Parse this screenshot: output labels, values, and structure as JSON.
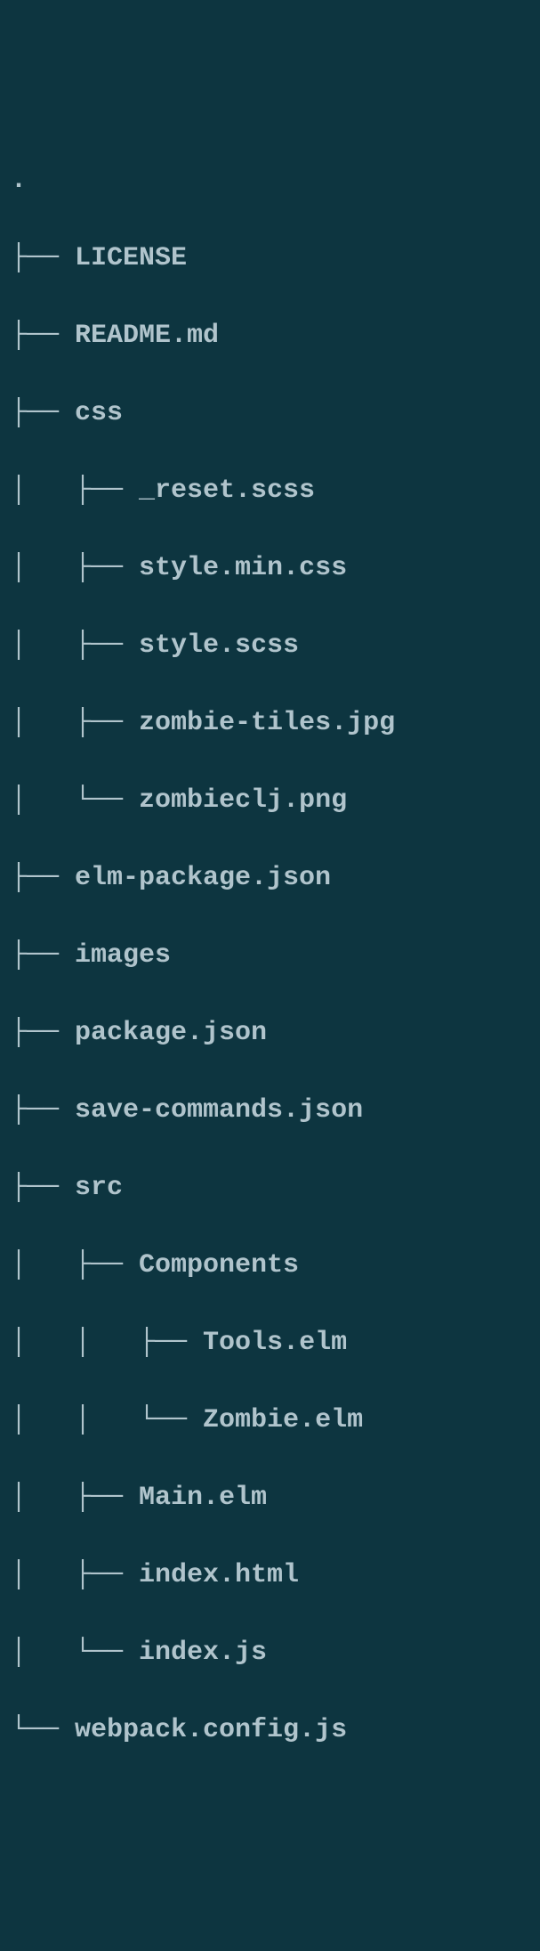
{
  "tree": {
    "root_marker": ".",
    "lines": [
      {
        "prefix": "├── ",
        "name": "LICENSE"
      },
      {
        "prefix": "├── ",
        "name": "README.md"
      },
      {
        "prefix": "├── ",
        "name": "css"
      },
      {
        "prefix": "│   ├── ",
        "name": "_reset.scss"
      },
      {
        "prefix": "│   ├── ",
        "name": "style.min.css"
      },
      {
        "prefix": "│   ├── ",
        "name": "style.scss"
      },
      {
        "prefix": "│   ├── ",
        "name": "zombie-tiles.jpg"
      },
      {
        "prefix": "│   └── ",
        "name": "zombieclj.png"
      },
      {
        "prefix": "├── ",
        "name": "elm-package.json"
      },
      {
        "prefix": "├── ",
        "name": "images"
      },
      {
        "prefix": "├── ",
        "name": "package.json"
      },
      {
        "prefix": "├── ",
        "name": "save-commands.json"
      },
      {
        "prefix": "├── ",
        "name": "src"
      },
      {
        "prefix": "│   ├── ",
        "name": "Components"
      },
      {
        "prefix": "│   │   ├── ",
        "name": "Tools.elm"
      },
      {
        "prefix": "│   │   └── ",
        "name": "Zombie.elm"
      },
      {
        "prefix": "│   ├── ",
        "name": "Main.elm"
      },
      {
        "prefix": "│   ├── ",
        "name": "index.html"
      },
      {
        "prefix": "│   └── ",
        "name": "index.js"
      },
      {
        "prefix": "└── ",
        "name": "webpack.config.js"
      }
    ]
  }
}
